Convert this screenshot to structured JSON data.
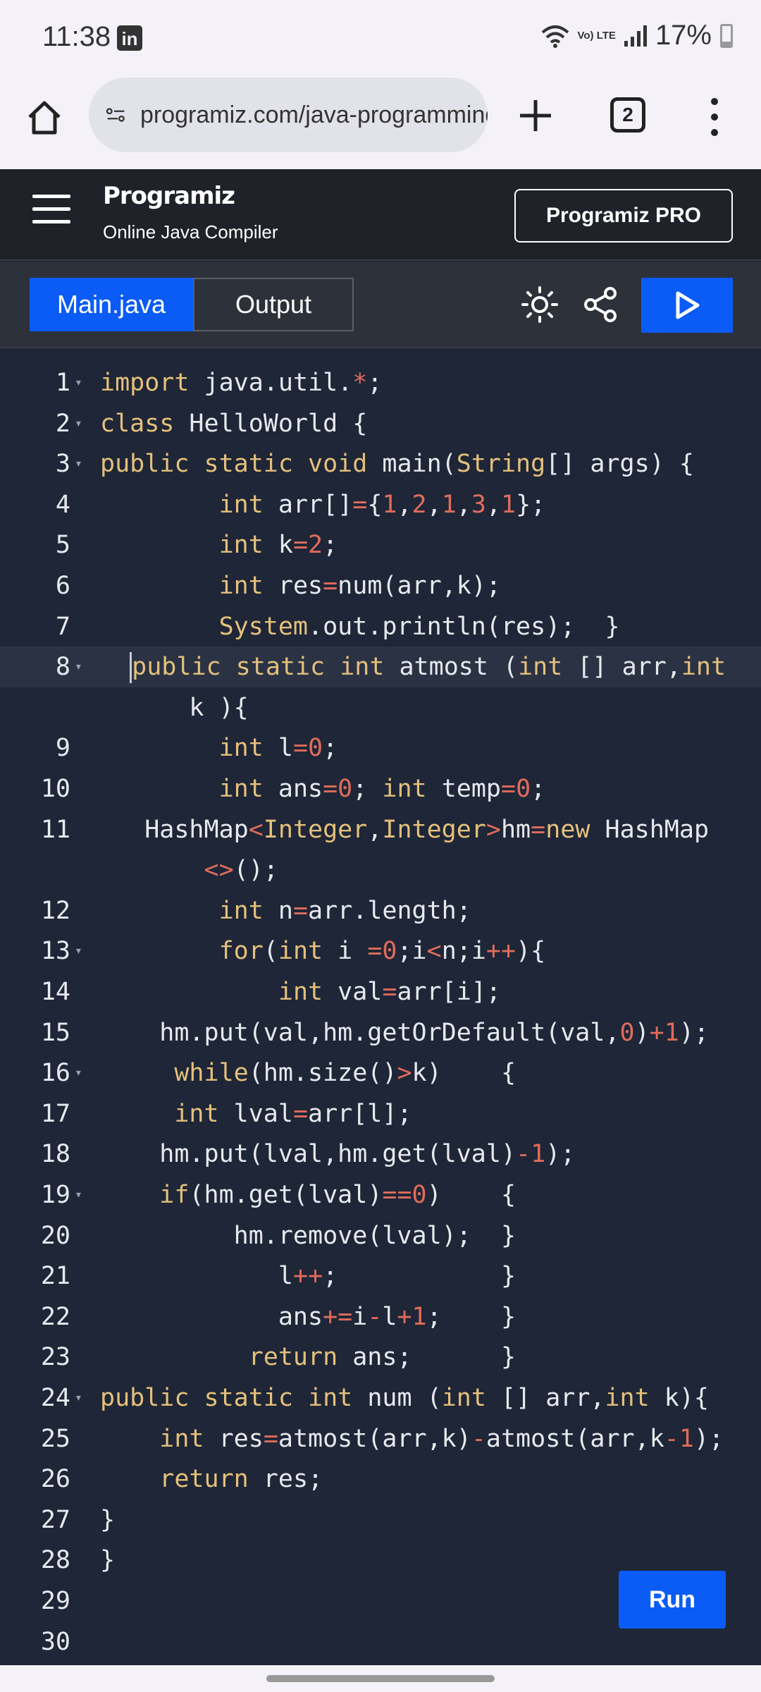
{
  "status_bar": {
    "time": "11:38",
    "app_badge": "in",
    "network": "Vo) LTE",
    "battery": "17%"
  },
  "browser": {
    "url": "programiz.com/java-programming/online-compiler",
    "tab_count": "2"
  },
  "header": {
    "logo": "Programiz",
    "subtitle": "Online Java Compiler",
    "pro_button": "Programiz PRO"
  },
  "toolbar": {
    "tabs": [
      "Main.java",
      "Output"
    ]
  },
  "editor": {
    "line_numbers": [
      "1",
      "2",
      "3",
      "4",
      "5",
      "6",
      "7",
      "8",
      "",
      "9",
      "10",
      "11",
      "",
      "12",
      "13",
      "14",
      "15",
      "16",
      "17",
      "18",
      "19",
      "20",
      "21",
      "22",
      "23",
      "24",
      "25",
      "26",
      "27",
      "28",
      "29",
      "30"
    ],
    "lines": [
      "import java.util.*;",
      "class HelloWorld {",
      "public static void main(String[] args) {",
      "        int arr[]={1,2,1,3,1};",
      "        int k=2;",
      "        int res=num(arr,k);",
      "        System.out.println(res);  }",
      "  public static int atmost (int [] arr,int",
      "      k ){",
      "        int l=0;",
      "        int ans=0; int temp=0;",
      "   HashMap<Integer,Integer>hm=new HashMap",
      "       <>();",
      "        int n=arr.length;",
      "        for(int i =0;i<n;i++){",
      "            int val=arr[i];",
      "    hm.put(val,hm.getOrDefault(val,0)+1);",
      "     while(hm.size()>k)    {",
      "     int lval=arr[l];",
      "    hm.put(lval,hm.get(lval)-1);",
      "    if(hm.get(lval)==0)    {",
      "         hm.remove(lval);  }",
      "            l++;           }",
      "            ans+=i-l+1;    }",
      "          return ans;      }",
      "public static int num (int [] arr,int k){",
      "    int res=atmost(arr,k)-atmost(arr,k-1);",
      "    return res;",
      "}",
      "}",
      "",
      ""
    ]
  },
  "run_button": "Run",
  "colors": {
    "accent": "#0b5cf6",
    "editor_bg": "#1e2637",
    "keyword": "#e5c07b",
    "number": "#e06c5b"
  }
}
